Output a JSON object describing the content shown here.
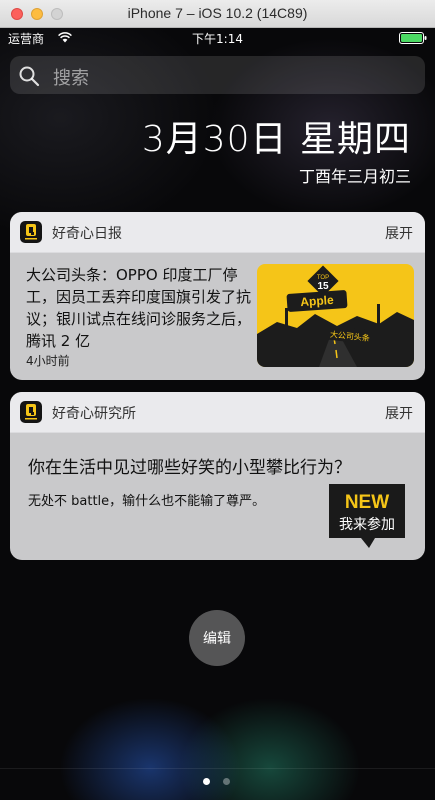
{
  "window": {
    "title": "iPhone 7 – iOS 10.2 (14C89)"
  },
  "status_bar": {
    "carrier": "运营商",
    "time": "下午1:14",
    "battery_color": "#4cd964"
  },
  "search": {
    "placeholder": "搜索"
  },
  "date": {
    "main": "3月30日 星期四",
    "lunar": "丁酉年三月初三"
  },
  "widgets": [
    {
      "app_name": "好奇心日报",
      "expand_label": "展开",
      "headline": "大公司头条：OPPO 印度工厂停工，因员工丢弃印度国旗引发了抗议；银川试点在线问诊服务之后，腾讯 2 亿",
      "time_ago": "4小时前",
      "image": {
        "badge_top": "TOP",
        "badge_num": "15",
        "brand": "Apple",
        "tag": "大公司头条"
      }
    },
    {
      "app_name": "好奇心研究所",
      "expand_label": "展开",
      "question": "你在生活中见过哪些好笑的小型攀比行为？",
      "subtitle": "无处不 battle，输什么也不能输了尊严。",
      "badge": {
        "new": "NEW",
        "cta": "我来参加"
      }
    }
  ],
  "edit_button": "编辑",
  "page_dots": {
    "count": 2,
    "active": 0
  },
  "colors": {
    "accent_yellow": "#f5c518",
    "app_icon_bg": "#141414"
  }
}
